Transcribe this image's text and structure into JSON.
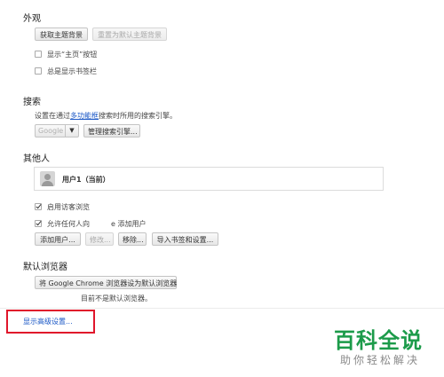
{
  "appearance": {
    "heading": "外观",
    "get_themes_label": "获取主题背景",
    "reset_theme_label": "重置为默认主题背景",
    "show_home_label": "显示“主页”按钮",
    "show_bookmarks_label": "总是显示书签栏"
  },
  "search": {
    "heading": "搜索",
    "desc_prefix": "设置在通过",
    "omnibox_link": "多功能框",
    "desc_suffix": "搜索时所用的搜索引擎。",
    "engine_value": "Google",
    "manage_label": "管理搜索引擎..."
  },
  "people": {
    "heading": "其他人",
    "profile_name": "用户1（当前）",
    "guest_label": "启用访客浏览",
    "allow_add_label_a": "允许任何人向",
    "allow_add_label_b": "e 添加用户",
    "add_user_label": "添加用户...",
    "edit_label": "修改...",
    "remove_label": "移除...",
    "import_label": "导入书签和设置..."
  },
  "default_browser": {
    "heading": "默认浏览器",
    "make_default_label": "将 Google Chrome 浏览器设为默认浏览器",
    "status": "目前不是默认浏览器。"
  },
  "advanced": {
    "link_label": "显示高级设置..."
  },
  "watermark": {
    "main": "百科全说",
    "sub": "助你轻松解决"
  },
  "colors": {
    "highlight": "#e0162b",
    "link": "#1a57c6",
    "watermark": "#1c9b4a"
  }
}
